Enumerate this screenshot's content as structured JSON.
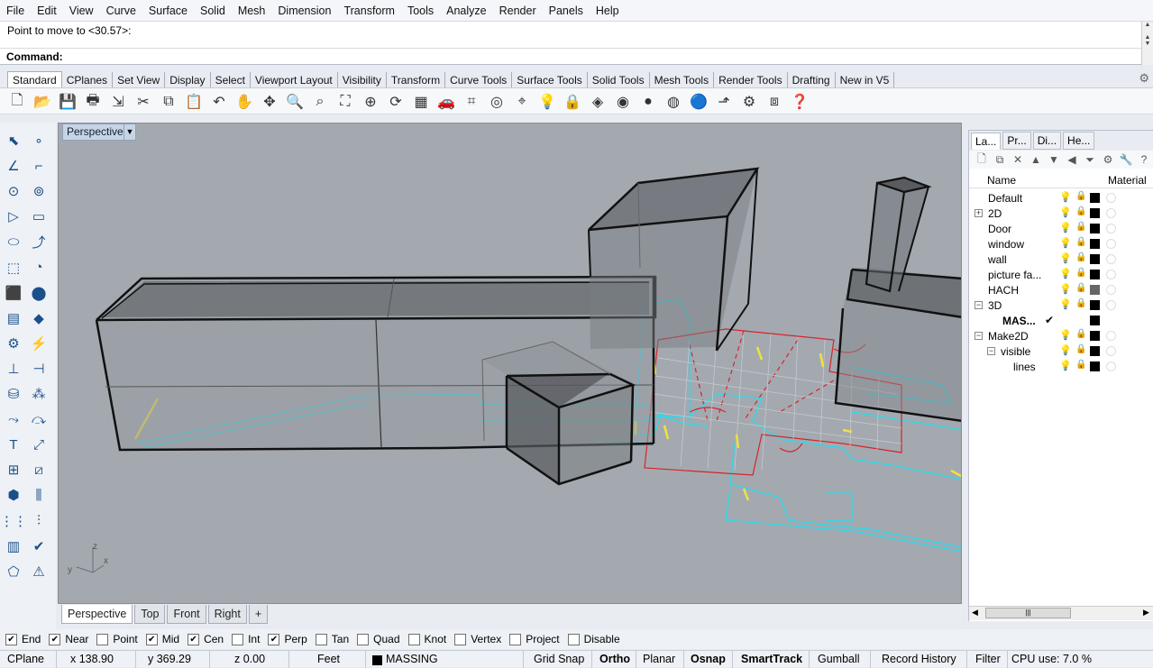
{
  "menu": [
    "File",
    "Edit",
    "View",
    "Curve",
    "Surface",
    "Solid",
    "Mesh",
    "Dimension",
    "Transform",
    "Tools",
    "Analyze",
    "Render",
    "Panels",
    "Help"
  ],
  "command": {
    "history": "Point to move to <30.57>:",
    "prompt_label": "Command:",
    "value": ""
  },
  "toolbar_tabs": [
    "Standard",
    "CPlanes",
    "Set View",
    "Display",
    "Select",
    "Viewport Layout",
    "Visibility",
    "Transform",
    "Curve Tools",
    "Surface Tools",
    "Solid Tools",
    "Mesh Tools",
    "Render Tools",
    "Drafting",
    "New in V5"
  ],
  "toolbar_tabs_active": "Standard",
  "toolbar_icons": [
    "new-file-icon",
    "open-file-icon",
    "save-icon",
    "print-icon",
    "import-icon",
    "cut-icon",
    "copy-icon",
    "paste-icon",
    "undo-icon",
    "pan-icon",
    "move-icon",
    "zoom-icon",
    "zoom-window-icon",
    "zoom-extents-icon",
    "zoom-selected-icon",
    "rotate-view-icon",
    "four-viewports-icon",
    "car-icon",
    "grid-icon",
    "target-icon",
    "snap-icon",
    "light-bulb-icon",
    "lock-icon",
    "layer-icon",
    "color-wheel-icon",
    "sphere-shaded-icon",
    "sphere-render-icon",
    "sphere-blue-icon",
    "select-icon",
    "settings-icon",
    "explode-icon",
    "help-icon"
  ],
  "viewport": {
    "title": "Perspective",
    "axis_labels": {
      "y": "y",
      "z": "z",
      "x": "x"
    }
  },
  "viewport_tabs": [
    "Perspective",
    "Top",
    "Front",
    "Right",
    "+"
  ],
  "viewport_tabs_active": "Perspective",
  "panel_tabs": [
    "La...",
    "Pr...",
    "Di...",
    "He..."
  ],
  "layers_header": {
    "name": "Name",
    "material": "Material"
  },
  "layers": [
    {
      "name": "Default",
      "indent": 0,
      "expander": "",
      "bold": false
    },
    {
      "name": "2D",
      "indent": 0,
      "expander": "+",
      "bold": false
    },
    {
      "name": "Door",
      "indent": 0,
      "expander": "",
      "bold": false
    },
    {
      "name": "window",
      "indent": 0,
      "expander": "",
      "bold": false
    },
    {
      "name": "wall",
      "indent": 0,
      "expander": "",
      "bold": false
    },
    {
      "name": "picture fa...",
      "indent": 0,
      "expander": "",
      "bold": false
    },
    {
      "name": "HACH",
      "indent": 0,
      "expander": "",
      "bold": false
    },
    {
      "name": "3D",
      "indent": 0,
      "expander": "-",
      "bold": false
    },
    {
      "name": "MAS...",
      "indent": 1,
      "expander": "",
      "bold": true,
      "current": "✔"
    },
    {
      "name": "Make2D",
      "indent": 0,
      "expander": "-",
      "bold": false
    },
    {
      "name": "visible",
      "indent": 1,
      "expander": "-",
      "bold": false
    },
    {
      "name": "lines",
      "indent": 2,
      "expander": "",
      "bold": false
    }
  ],
  "osnaps": [
    {
      "label": "End",
      "checked": true
    },
    {
      "label": "Near",
      "checked": true
    },
    {
      "label": "Point",
      "checked": false
    },
    {
      "label": "Mid",
      "checked": true
    },
    {
      "label": "Cen",
      "checked": true
    },
    {
      "label": "Int",
      "checked": false
    },
    {
      "label": "Perp",
      "checked": true
    },
    {
      "label": "Tan",
      "checked": false
    },
    {
      "label": "Quad",
      "checked": false
    },
    {
      "label": "Knot",
      "checked": false
    },
    {
      "label": "Vertex",
      "checked": false
    },
    {
      "label": "Project",
      "checked": false
    },
    {
      "label": "Disable",
      "checked": false
    }
  ],
  "status": {
    "cplane": "CPlane",
    "x": "x 138.90",
    "y": "y 369.29",
    "z": "z 0.00",
    "units": "Feet",
    "layer": "MASSING",
    "grid_snap": "Grid Snap",
    "ortho": "Ortho",
    "planar": "Planar",
    "osnap": "Osnap",
    "smarttrack": "SmartTrack",
    "gumball": "Gumball",
    "record_history": "Record History",
    "filter": "Filter",
    "cpu": "CPU use: 7.0 %"
  },
  "colors": {
    "viewport_bg": "#a4a9b0",
    "cyan_lines": "#35d6e6",
    "red_lines": "#d8232a",
    "yellow_lines": "#f0e23c"
  }
}
